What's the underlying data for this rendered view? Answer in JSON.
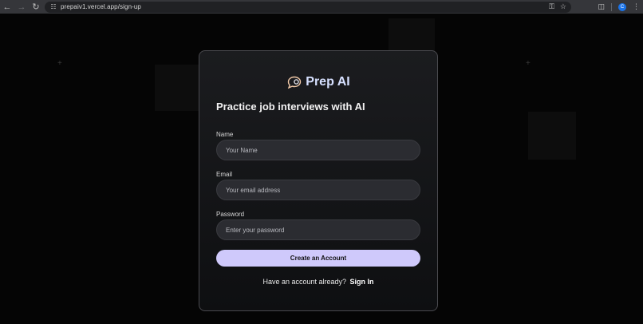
{
  "browser": {
    "url": "prepaiv1.vercel.app/sign-up",
    "back_icon": "arrow-left-icon",
    "forward_icon": "arrow-right-icon",
    "reload_icon": "reload-icon",
    "profile_initial": "C"
  },
  "brand": {
    "name": "Prep AI",
    "icon": "chat-bubble-icon"
  },
  "tagline": "Practice job interviews with AI",
  "form": {
    "name": {
      "label": "Name",
      "placeholder": "Your Name"
    },
    "email": {
      "label": "Email",
      "placeholder": "Your email address"
    },
    "password": {
      "label": "Password",
      "placeholder": "Enter your password"
    },
    "submit_label": "Create an Account"
  },
  "footer": {
    "prompt": "Have an account already?",
    "link_label": "Sign In"
  },
  "colors": {
    "accent_button": "#cfc9fb",
    "brand_text": "#d6e0ff",
    "background": "#050505"
  }
}
